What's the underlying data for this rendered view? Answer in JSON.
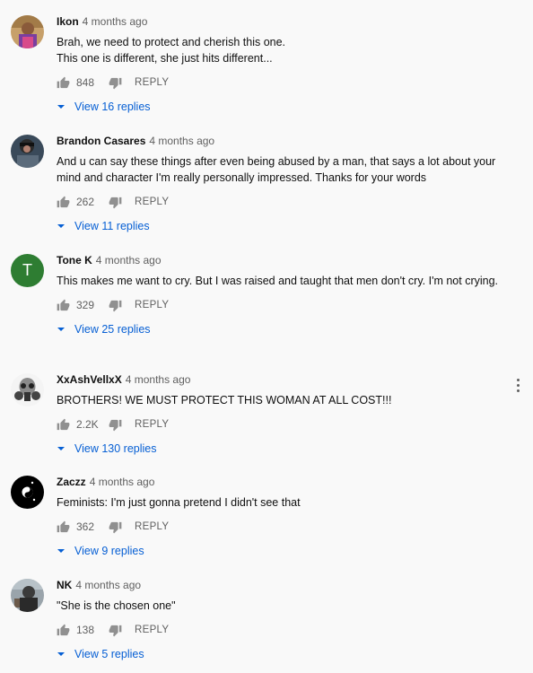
{
  "comments": [
    {
      "author": "Ikon",
      "time": "4 months ago",
      "text": "Brah, we need to protect and cherish this one.\nThis one is different, she just hits different...",
      "likes": "848",
      "reply_label": "REPLY",
      "view_replies": "View 16 replies",
      "avatar_icon": "person-photo-icon"
    },
    {
      "author": "Brandon Casares",
      "time": "4 months ago",
      "text": "And u can say these things after even being abused by a man, that says a lot about your mind and character I'm really personally impressed. Thanks for your words",
      "likes": "262",
      "reply_label": "REPLY",
      "view_replies": "View 11 replies",
      "avatar_icon": "person-photo-icon"
    },
    {
      "author": "Tone K",
      "time": "4 months ago",
      "text": "This makes me want to cry. But I was raised and taught that men don't cry. I'm not crying.",
      "likes": "329",
      "reply_label": "REPLY",
      "view_replies": "View 25 replies",
      "avatar_letter": "T",
      "avatar_color": "#2e7d32"
    },
    {
      "author": "XxAshVellxX",
      "time": "4 months ago",
      "text": "BROTHERS! WE MUST PROTECT THIS WOMAN AT ALL COST!!!",
      "likes": "2.2K",
      "reply_label": "REPLY",
      "view_replies": "View 130 replies",
      "avatar_icon": "gas-mask-icon"
    },
    {
      "author": "Zaczz",
      "time": "4 months ago",
      "text": "Feminists: I'm just gonna pretend I didn't see that",
      "likes": "362",
      "reply_label": "REPLY",
      "view_replies": "View 9 replies",
      "avatar_icon": "yin-yang-icon"
    },
    {
      "author": "NK",
      "time": "4 months ago",
      "text": "\"She is the chosen one\"",
      "likes": "138",
      "reply_label": "REPLY",
      "view_replies": "View 5 replies",
      "avatar_icon": "person-photo-icon"
    }
  ],
  "colors": {
    "link": "#065fd4",
    "meta": "#606060",
    "background": "#f9f9f9"
  }
}
